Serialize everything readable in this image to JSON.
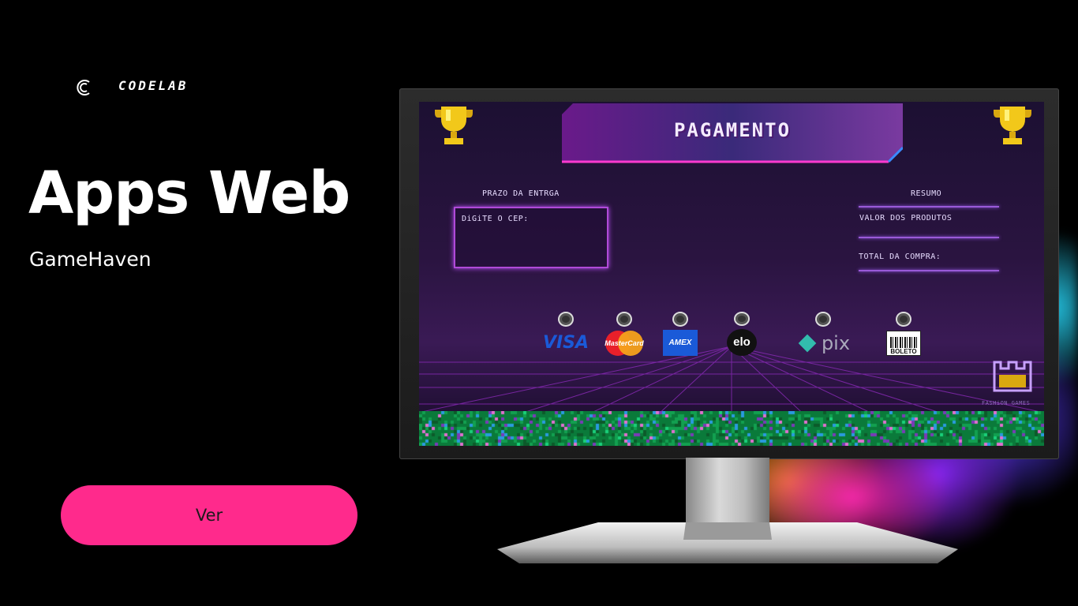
{
  "brand": {
    "name": "CODELAB",
    "logo_icon": "codelab-c-icon"
  },
  "hero": {
    "title": "Apps Web",
    "subtitle": "GameHaven"
  },
  "cta": {
    "label": "Ver"
  },
  "screen": {
    "header": {
      "title": "PAGAMENTO"
    },
    "delivery": {
      "heading": "PRAZO DA ENTRGA",
      "cep_label": "DiGiTE O CEP:"
    },
    "summary": {
      "heading": "RESUMO",
      "products_label": "VALOR DOS PRODUTOS",
      "total_label": "TOTAL DA COMPRA:"
    },
    "payment_methods": [
      {
        "name": "VISA",
        "icon": "visa-logo"
      },
      {
        "name": "MasterCard",
        "icon": "mastercard-logo"
      },
      {
        "name": "AMEX",
        "icon": "amex-logo"
      },
      {
        "name": "elo",
        "icon": "elo-logo"
      },
      {
        "name": "pix",
        "icon": "pix-logo"
      },
      {
        "name": "BOLETO",
        "icon": "boleto-barcode-logo"
      }
    ],
    "footer_brand": "FASHiON GAMES",
    "colors": {
      "accent": "#ff2a8c",
      "neon": "#b04ad8",
      "background": "#000000"
    }
  }
}
